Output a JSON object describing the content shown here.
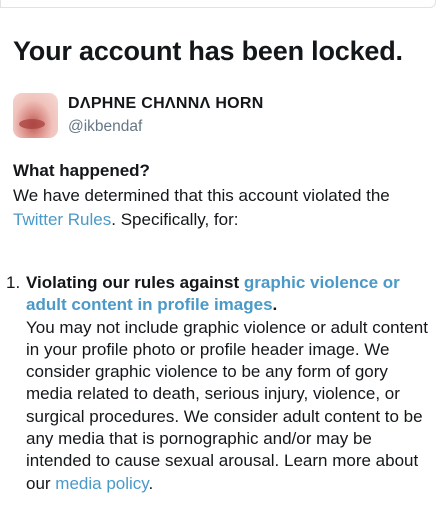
{
  "title": "Your account has been locked.",
  "account": {
    "display_name": "DΛPHNE CHΛNNΛ HORN",
    "handle": "@ikbendaf"
  },
  "what_happened": {
    "heading": "What happened?",
    "text_before": "We have determined that this account violated the ",
    "rules_link": "Twitter Rules",
    "text_after": ". Specifically, for:"
  },
  "violation": {
    "number": "1.",
    "rule_prefix": "Violating our rules against ",
    "rule_link": "graphic violence or adult content in profile images",
    "rule_suffix": ".",
    "description": "You may not include graphic violence or adult content in your profile photo or profile header image. We consider graphic violence to be any form of gory media related to death, serious injury, violence, or surgical procedures. We consider adult content to be any media that is pornographic and/or may be intended to cause sexual arousal. Learn more about our ",
    "policy_link": "media policy",
    "policy_suffix": "."
  },
  "colors": {
    "link": "#4a99c8",
    "text": "#14171a",
    "secondary_text": "#657786"
  }
}
